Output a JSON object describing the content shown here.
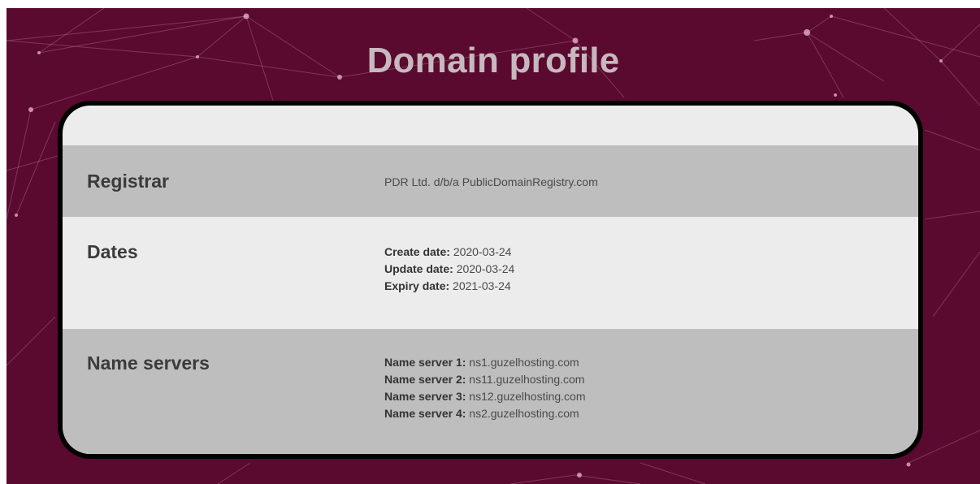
{
  "page": {
    "title": "Domain profile"
  },
  "colors": {
    "background": "#5a0a2e",
    "card_border": "#000000",
    "row_shaded": "#bebebe",
    "row_light": "#ececec",
    "title_text": "#c7b8bf"
  },
  "registrar": {
    "label": "Registrar",
    "value": "PDR Ltd. d/b/a PublicDomainRegistry.com"
  },
  "dates": {
    "label": "Dates",
    "items": [
      {
        "key": "Create date:",
        "value": "2020-03-24"
      },
      {
        "key": "Update date:",
        "value": "2020-03-24"
      },
      {
        "key": "Expiry date:",
        "value": "2021-03-24"
      }
    ]
  },
  "name_servers": {
    "label": "Name servers",
    "items": [
      {
        "key": "Name server 1:",
        "value": "ns1.guzelhosting.com"
      },
      {
        "key": "Name server 2:",
        "value": "ns11.guzelhosting.com"
      },
      {
        "key": "Name server 3:",
        "value": "ns12.guzelhosting.com"
      },
      {
        "key": "Name server 4:",
        "value": "ns2.guzelhosting.com"
      }
    ]
  }
}
